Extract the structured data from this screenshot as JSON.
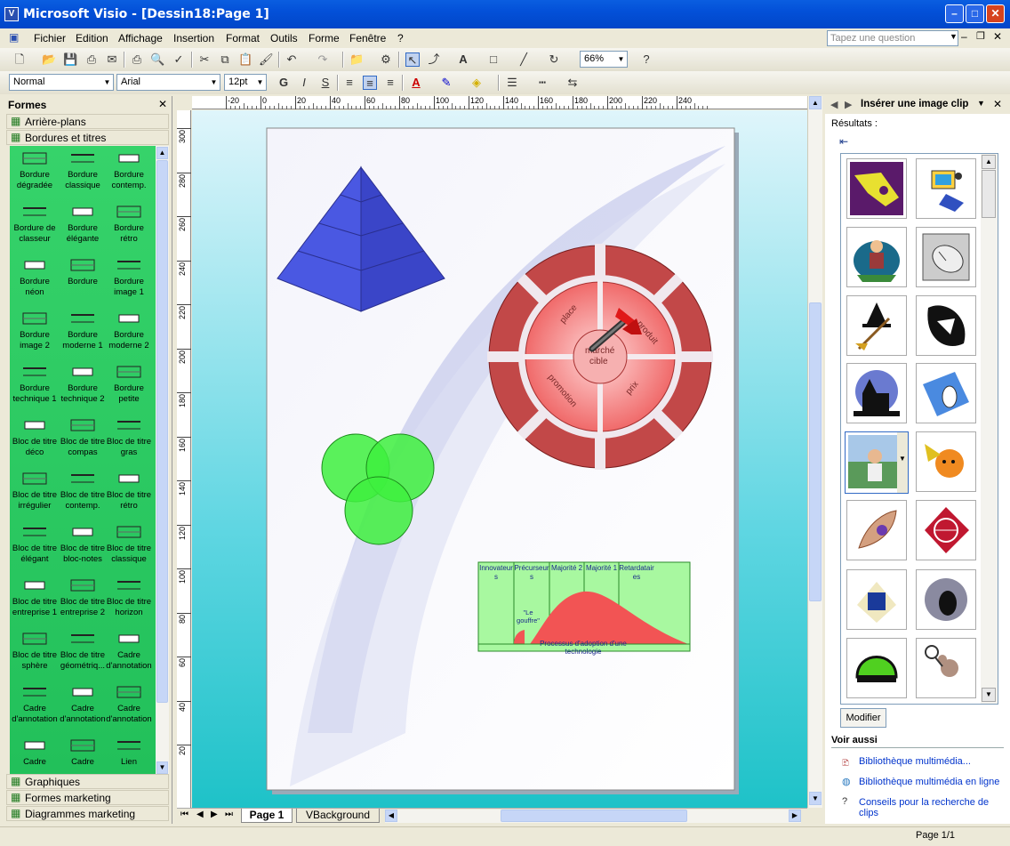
{
  "window": {
    "title": "Microsoft Visio - [Dessin18:Page 1]"
  },
  "menu": [
    "Fichier",
    "Edition",
    "Affichage",
    "Insertion",
    "Format",
    "Outils",
    "Forme",
    "Fenêtre",
    "?"
  ],
  "help_placeholder": "Tapez une question",
  "toolbar": {
    "zoom": "66%",
    "style": "Normal",
    "font": "Arial",
    "size": "12pt",
    "bold": "G",
    "italic": "I",
    "shadow": "S"
  },
  "shapes_panel": {
    "title": "Formes",
    "top_stencils": [
      "Arrière-plans",
      "Bordures et titres"
    ],
    "items": [
      "Bordure dégradée",
      "Bordure classique",
      "Bordure contemp.",
      "Bordure de classeur",
      "Bordure élégante",
      "Bordure rétro",
      "Bordure néon",
      "Bordure",
      "Bordure image 1",
      "Bordure image 2",
      "Bordure moderne 1",
      "Bordure moderne 2",
      "Bordure technique 1",
      "Bordure technique 2",
      "Bordure petite",
      "Bloc de titre déco",
      "Bloc de titre compas",
      "Bloc de titre gras",
      "Bloc de titre irrégulier",
      "Bloc de titre contemp.",
      "Bloc de titre rétro",
      "Bloc de titre élégant",
      "Bloc de titre bloc-notes",
      "Bloc de titre classique",
      "Bloc de titre entreprise 1",
      "Bloc de titre entreprise 2",
      "Bloc de titre horizon",
      "Bloc de titre sphère",
      "Bloc de titre géométriq...",
      "Cadre d'annotation",
      "Cadre d'annotation",
      "Cadre d'annotation",
      "Cadre d'annotation",
      "Cadre",
      "Cadre",
      "Lien"
    ],
    "bottom_stencils": [
      "Graphiques",
      "Formes marketing",
      "Diagrammes marketing"
    ]
  },
  "ruler_h": [
    "-20",
    "0",
    "20",
    "40",
    "60",
    "80",
    "100",
    "120",
    "140",
    "160",
    "180",
    "200",
    "220",
    "240"
  ],
  "ruler_v": [
    "300",
    "280",
    "260",
    "240",
    "220",
    "200",
    "180",
    "160",
    "140",
    "120",
    "100",
    "80",
    "60",
    "40",
    "20"
  ],
  "drawing": {
    "target_labels": {
      "place": "place",
      "produit": "produit",
      "promotion": "promotion",
      "prix": "prix",
      "center1": "marché",
      "center2": "cible"
    },
    "chart_columns": [
      "Innovateur s",
      "Précurseur s",
      "Majorité 2",
      "Majorité 1",
      "Retardatair es"
    ],
    "gap_label": "\"Le gouffre\"",
    "chart_caption": "Processus d'adoption d'une technologie"
  },
  "tabs": [
    "Page 1",
    "VBackground"
  ],
  "task_pane": {
    "title": "Insérer une image clip",
    "results_label": "Résultats :",
    "modify_button": "Modifier",
    "see_also": "Voir aussi",
    "links": [
      "Bibliothèque multimédia...",
      "Bibliothèque multimédia en ligne",
      "Conseils pour la recherche de clips"
    ]
  },
  "status": {
    "page": "Page 1/1"
  }
}
